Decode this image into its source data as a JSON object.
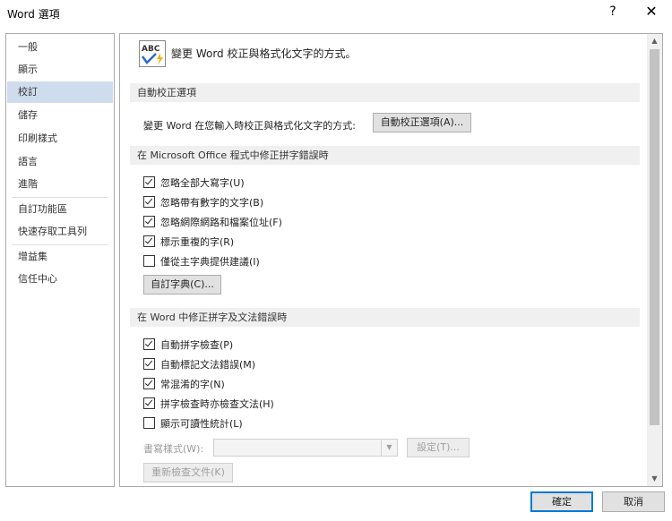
{
  "window": {
    "title": "Word 選項",
    "help_label": "?",
    "close_label": "✕"
  },
  "nav": {
    "items": [
      {
        "label": "一般"
      },
      {
        "label": "顯示"
      },
      {
        "label": "校訂"
      },
      {
        "label": "儲存"
      },
      {
        "label": "印刷樣式"
      },
      {
        "label": "語言"
      },
      {
        "label": "進階"
      },
      {
        "label": "自訂功能區"
      },
      {
        "label": "快速存取工具列"
      },
      {
        "label": "增益集"
      },
      {
        "label": "信任中心"
      }
    ],
    "selected": "校訂"
  },
  "content": {
    "header": "變更 Word 校正與格式化文字的方式。",
    "icon_text": "ABC",
    "autocorrect": {
      "section_title": "自動校正選項",
      "row_label": "變更 Word 在您輸入時校正與格式化文字的方式:",
      "button_label": "自動校正選項(A)..."
    },
    "office_spelling": {
      "section_title": "在 Microsoft Office 程式中修正拼字錯誤時",
      "options": [
        {
          "label": "忽略全部大寫字(U)",
          "checked": true
        },
        {
          "label": "忽略帶有數字的文字(B)",
          "checked": true
        },
        {
          "label": "忽略網際網路和檔案位址(F)",
          "checked": true
        },
        {
          "label": "標示重複的字(R)",
          "checked": true
        },
        {
          "label": "僅從主字典提供建議(I)",
          "checked": false
        }
      ],
      "custom_dict_label": "自訂字典(C)..."
    },
    "word_grammar": {
      "section_title": "在 Word 中修正拼字及文法錯誤時",
      "options": [
        {
          "label": "自動拼字檢查(P)",
          "checked": true
        },
        {
          "label": "自動標記文法錯誤(M)",
          "checked": true
        },
        {
          "label": "常混淆的字(N)",
          "checked": true
        },
        {
          "label": "拼字檢查時亦檢查文法(H)",
          "checked": true
        },
        {
          "label": "顯示可讀性統計(L)",
          "checked": false
        }
      ],
      "writing_style_label": "書寫樣式(W):",
      "writing_style_value": "",
      "settings_label": "設定(T)...",
      "recheck_label": "重新檢查文件(K)"
    }
  },
  "footer": {
    "ok_label": "確定",
    "cancel_label": "取消"
  }
}
